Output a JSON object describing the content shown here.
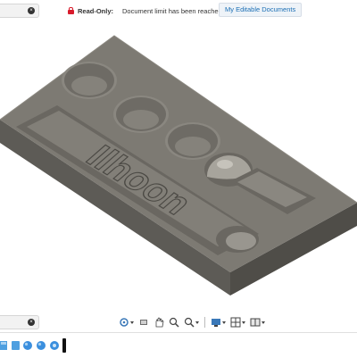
{
  "header": {
    "readonly_label": "Read-Only:",
    "readonly_message": "Document limit has been reached",
    "editable_documents_link": "My Editable Documents"
  },
  "model": {
    "engraved_text": "Ilhoon"
  },
  "navigation_toolbar": {
    "tools": [
      {
        "name": "orbit",
        "icon": "orbit-icon"
      },
      {
        "name": "look-at",
        "icon": "look-at-icon"
      },
      {
        "name": "pan",
        "icon": "hand-pan-icon"
      },
      {
        "name": "zoom",
        "icon": "zoom-icon"
      },
      {
        "name": "fit",
        "icon": "zoom-window-icon"
      },
      {
        "name": "display-settings",
        "icon": "display-settings-icon"
      },
      {
        "name": "grid-settings",
        "icon": "grid-settings-icon"
      },
      {
        "name": "viewports",
        "icon": "viewports-icon"
      }
    ]
  },
  "timeline": {
    "feature_icons": [
      "extrude-icon",
      "fillet-icon",
      "sphere-icon",
      "sphere-icon",
      "hole-icon"
    ]
  },
  "colors": {
    "model_top": "#7d7a73",
    "model_side": "#5c5a55",
    "lock_red": "#d81b2c",
    "link_blue": "#1c6fb5",
    "timeline_blue": "#4e9fe0"
  }
}
